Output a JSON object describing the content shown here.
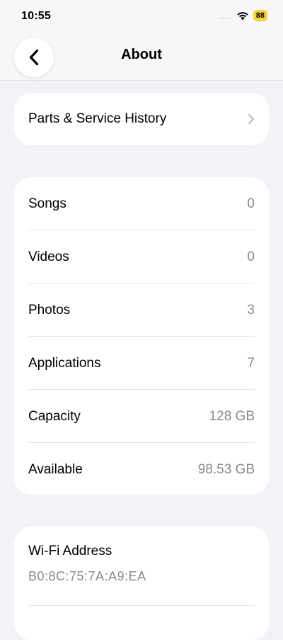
{
  "status_bar": {
    "time": "10:55",
    "signal": "....",
    "battery": "88",
    "battery_color": "#f5d33a"
  },
  "nav": {
    "title": "About"
  },
  "parts_service": {
    "label": "Parts & Service History"
  },
  "stats": [
    {
      "label": "Songs",
      "value": "0"
    },
    {
      "label": "Videos",
      "value": "0"
    },
    {
      "label": "Photos",
      "value": "3"
    },
    {
      "label": "Applications",
      "value": "7"
    },
    {
      "label": "Capacity",
      "value": "128 GB"
    },
    {
      "label": "Available",
      "value": "98.53 GB"
    }
  ],
  "wifi": {
    "label": "Wi-Fi Address",
    "value": "B0:8C:75:7A:A9:EA"
  }
}
